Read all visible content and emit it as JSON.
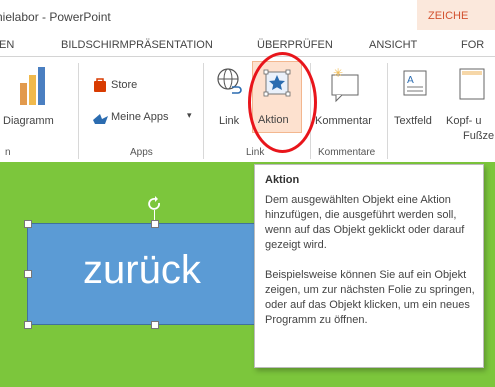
{
  "window": {
    "title": "nielabor - PowerPoint",
    "context_tab": "ZEICHE"
  },
  "tabs": [
    "EN",
    "BILDSCHIRMPRÄSENTATION",
    "ÜBERPRÜFEN",
    "ANSICHT",
    "FOR"
  ],
  "ribbon": {
    "diagramm": "Diagramm",
    "store": "Store",
    "meine_apps": "Meine Apps",
    "link": "Link",
    "aktion": "Aktion",
    "kommentar": "Kommentar",
    "textfeld": "Textfeld",
    "kopf_line1": "Kopf- u",
    "kopf_line2": "Fußze",
    "groups": {
      "first": "n",
      "apps": "Apps",
      "links": "Link",
      "kommentare": "Kommentare"
    }
  },
  "slide": {
    "shape_text": "zurück"
  },
  "tooltip": {
    "title": "Aktion",
    "para1": "Dem ausgewählten Objekt eine Aktion hinzufügen, die ausgeführt werden soll, wenn auf das Objekt geklickt oder darauf gezeigt wird.",
    "para2": "Beispielsweise können Sie auf ein Objekt zeigen, um zur nächsten Folie zu springen, oder auf das Objekt klicken, um ein neues Programm zu öffnen."
  },
  "colors": {
    "accent": "#d35230",
    "slide_bg": "#7cc63c",
    "shape": "#5b9bd5",
    "highlight": "#e8151b"
  }
}
